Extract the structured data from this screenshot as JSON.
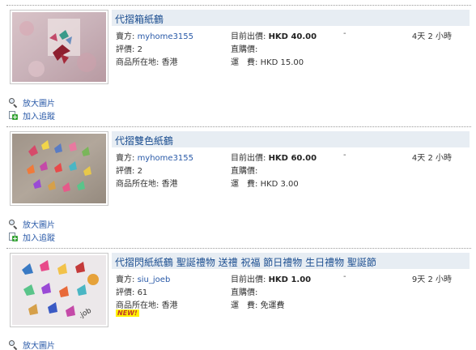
{
  "listings": [
    {
      "title": "代摺箱紙鶴",
      "seller_label": "賣方:",
      "seller": "myhome3155",
      "rating_label": "評價:",
      "rating": "2",
      "location_label": "商品所在地:",
      "location": "香港",
      "current_bid_label": "目前出價:",
      "current_bid": "HKD 40.00",
      "buy_now_label": "直購價:",
      "buy_now": "",
      "shipping_label": "運　費:",
      "shipping": "HKD 15.00",
      "bids": "-",
      "time_left": "4天 2 小時",
      "zoom_label": "放大圖片",
      "track_label": "加入追蹤",
      "new_badge": ""
    },
    {
      "title": "代摺雙色紙鶴",
      "seller_label": "賣方:",
      "seller": "myhome3155",
      "rating_label": "評價:",
      "rating": "2",
      "location_label": "商品所在地:",
      "location": "香港",
      "current_bid_label": "目前出價:",
      "current_bid": "HKD 60.00",
      "buy_now_label": "直購價:",
      "buy_now": "",
      "shipping_label": "運　費:",
      "shipping": "HKD 3.00",
      "bids": "-",
      "time_left": "4天 2 小時",
      "zoom_label": "放大圖片",
      "track_label": "加入追蹤",
      "new_badge": ""
    },
    {
      "title": "代摺閃紙紙鶴 聖誕禮物 送禮 祝福 節日禮物 生日禮物 聖誕節",
      "seller_label": "賣方:",
      "seller": "siu_joeb",
      "rating_label": "評價:",
      "rating": "61",
      "location_label": "商品所在地:",
      "location": "香港",
      "current_bid_label": "目前出價:",
      "current_bid": "HKD 1.00",
      "buy_now_label": "直購價:",
      "buy_now": "",
      "shipping_label": "運　費:",
      "shipping": "免運費",
      "bids": "-",
      "time_left": "9天 2 小時",
      "zoom_label": "放大圖片",
      "track_label": "",
      "new_badge": "NEW!"
    }
  ],
  "icons": {
    "zoom": "magnifier-icon",
    "track": "add-to-watchlist-icon"
  },
  "colors": {
    "title_bar": "#e7edf3",
    "link": "#2a5aa8",
    "title_text": "#1d4f91"
  }
}
